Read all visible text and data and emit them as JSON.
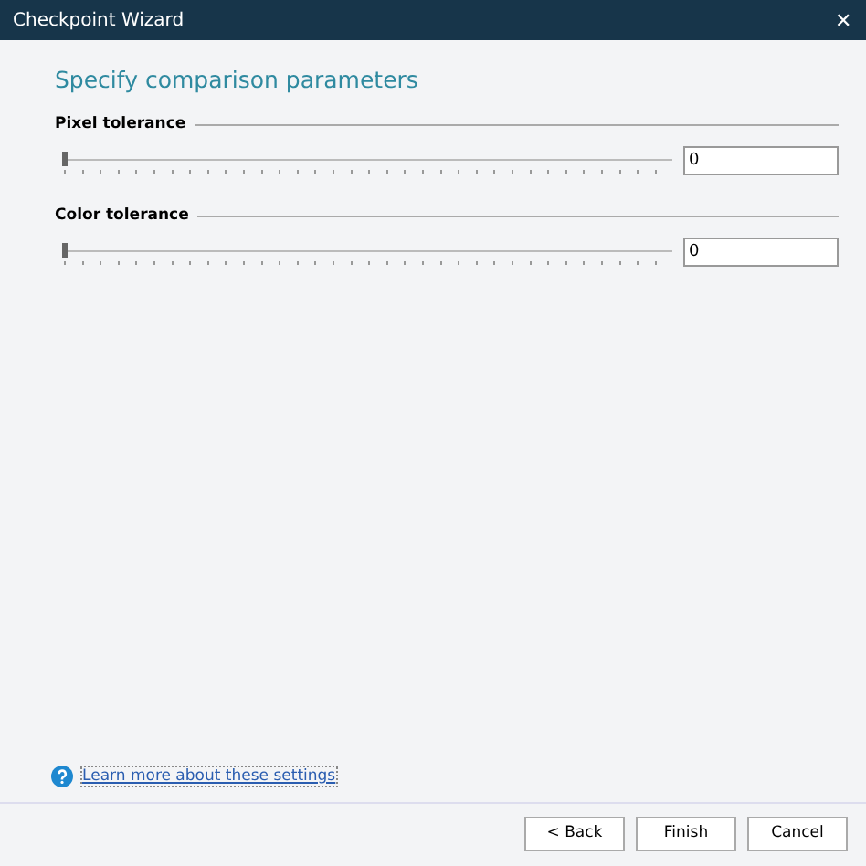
{
  "window": {
    "title": "Checkpoint Wizard",
    "close": "✕"
  },
  "heading": "Specify comparison parameters",
  "groups": [
    {
      "label": "Pixel tolerance",
      "level": 0,
      "value": "0"
    },
    {
      "label": "Color tolerance",
      "level": 0,
      "value": "0"
    }
  ],
  "help_link": "Learn more about these settings",
  "buttons": [
    "< Back",
    "Finish",
    "Cancel"
  ]
}
